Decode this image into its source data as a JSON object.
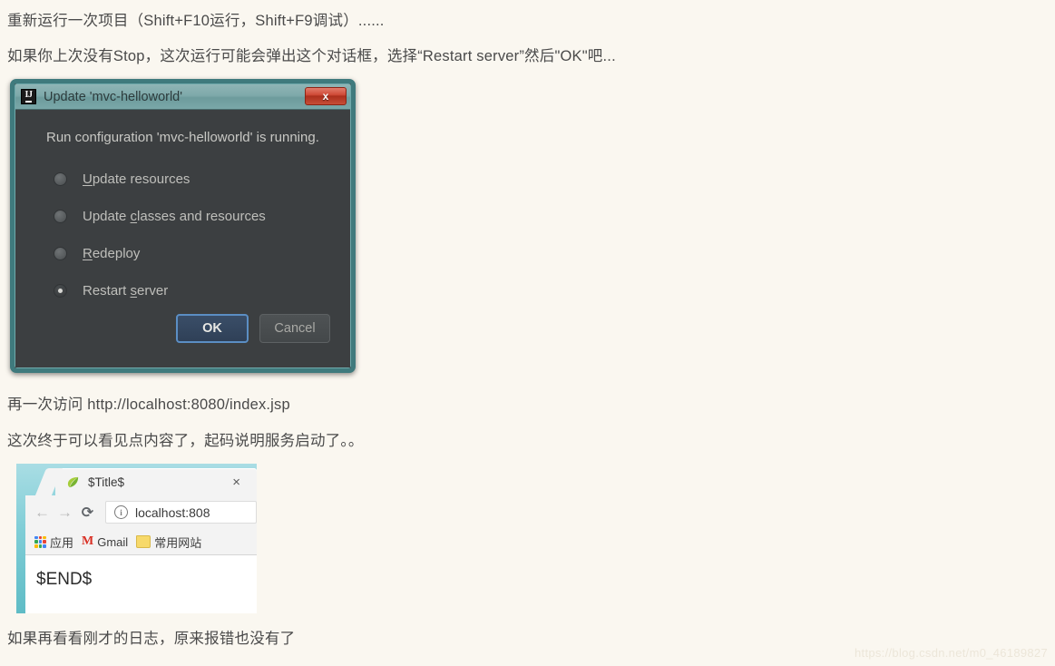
{
  "page": {
    "background_color": "#faf7f0",
    "paragraphs": [
      "重新运行一次项目（Shift+F10运行，Shift+F9调试）......",
      "如果你上次没有Stop，这次运行可能会弹出这个对话框，选择“Restart server”然后\"OK\"吧...",
      "再一次访问 http://localhost:8080/index.jsp",
      "这次终于可以看见点内容了，起码说明服务启动了。。",
      "如果再看看刚才的日志，原来报错也没有了"
    ],
    "watermark": "https://blog.csdn.net/m0_46189827"
  },
  "dialog": {
    "app_icon": "IJ",
    "title": "Update 'mvc-helloworld'",
    "close_label": "x",
    "message": "Run configuration 'mvc-helloworld' is running.",
    "options": [
      {
        "label": "Update resources",
        "mnemonic": "U",
        "before": "",
        "after": "pdate resources",
        "selected": false
      },
      {
        "label": "Update classes and resources",
        "mnemonic": "c",
        "before": "Update ",
        "after": "lasses and resources",
        "selected": false
      },
      {
        "label": "Redeploy",
        "mnemonic": "R",
        "before": "",
        "after": "edeploy",
        "selected": false
      },
      {
        "label": "Restart server",
        "mnemonic": "s",
        "before": "Restart ",
        "after": "erver",
        "selected": true
      }
    ],
    "ok_label": "OK",
    "cancel_label": "Cancel",
    "border_color": "#3f7a7d",
    "body_color": "#3c3f41"
  },
  "browser": {
    "tab": {
      "favicon": "tomcat-leaf-icon",
      "title": "$Title$",
      "close_label": "×"
    },
    "toolbar": {
      "back_label": "←",
      "forward_label": "→",
      "reload_label": "⟳",
      "security_icon_label": "i",
      "url": "localhost:808"
    },
    "bookmarks": [
      {
        "icon": "apps-grid-icon",
        "label": "应用"
      },
      {
        "icon": "gmail-icon",
        "label": "Gmail"
      },
      {
        "icon": "folder-icon",
        "label": "常用网站"
      }
    ],
    "page_content": "$END$"
  }
}
